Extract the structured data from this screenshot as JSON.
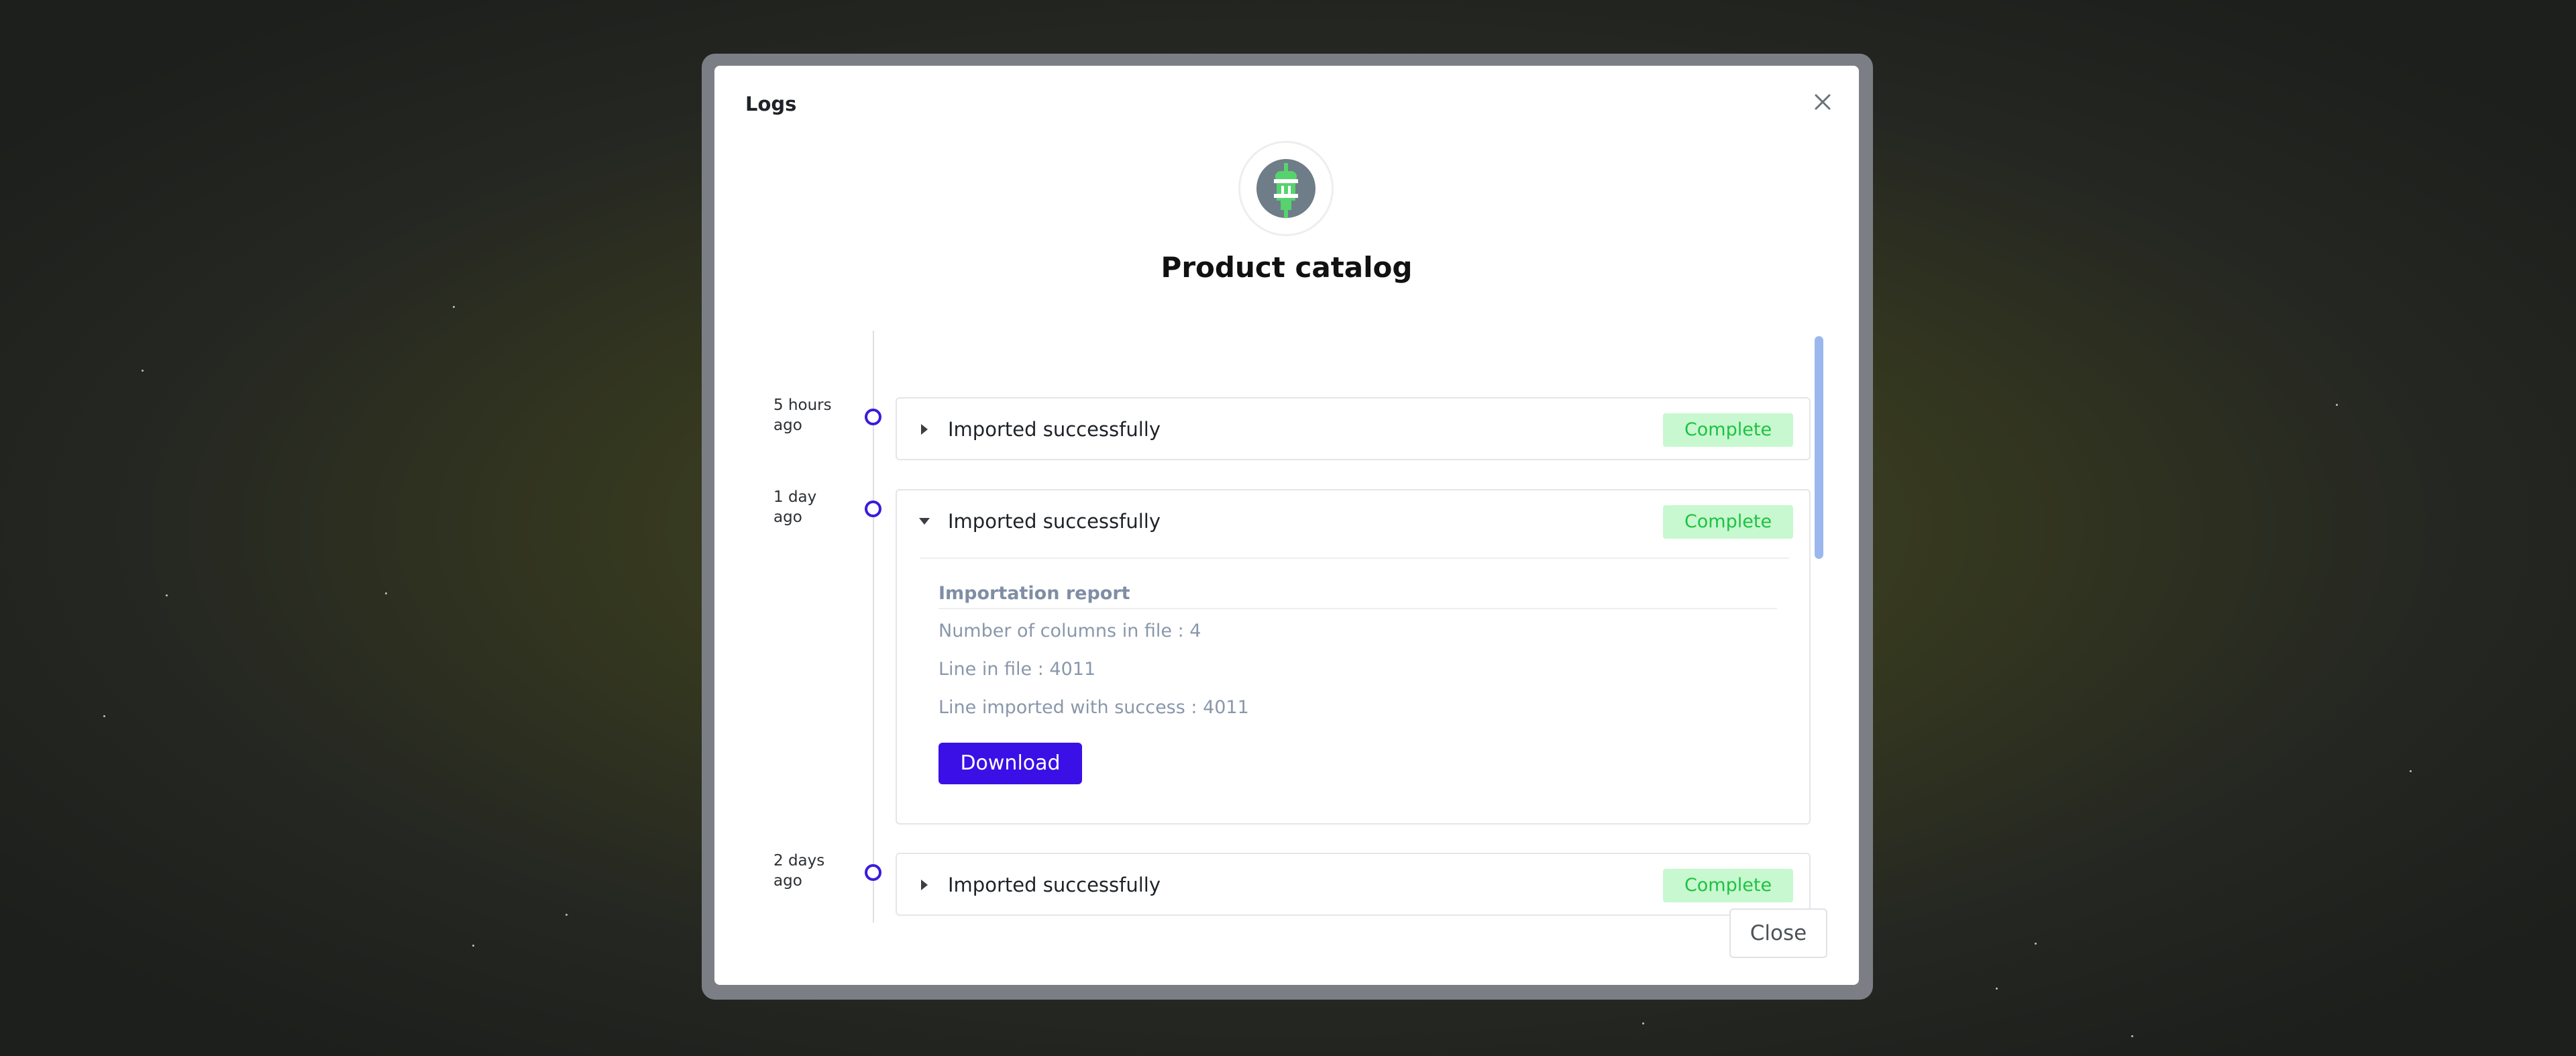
{
  "modal": {
    "title": "Logs",
    "product_title": "Product catalog",
    "close_icon": "close-icon",
    "logo_icon": "plug-icon",
    "close_button_label": "Close"
  },
  "timeline": [
    {
      "time": "5 hours\nago",
      "label": "Imported successfully",
      "status": "Complete",
      "expanded": false
    },
    {
      "time": "1 day\nago",
      "label": "Imported successfully",
      "status": "Complete",
      "expanded": true,
      "report": {
        "title": "Importation report",
        "lines": [
          "Number of columns in file : 4",
          "Line in file : 4011",
          "Line imported with success : 4011"
        ],
        "download_label": "Download"
      }
    },
    {
      "time": "2 days\nago",
      "label": "Imported successfully",
      "status": "Complete",
      "expanded": false
    }
  ],
  "colors": {
    "accent": "#3a10e6",
    "badge_bg": "#c8f8cf",
    "badge_text": "#1ec244",
    "dot": "#3a1cdb"
  }
}
